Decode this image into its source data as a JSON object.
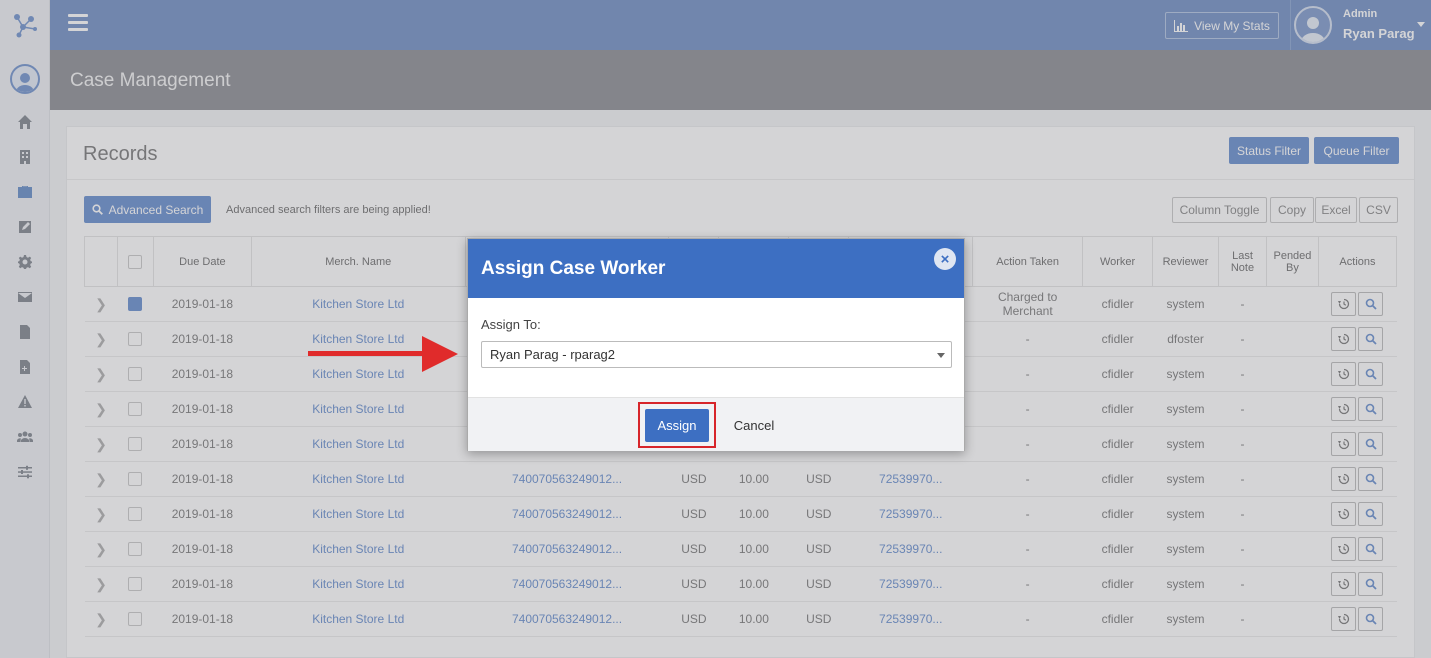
{
  "topbar": {
    "stats_label": "View My Stats",
    "user_role": "Admin",
    "user_name": "Ryan Parag"
  },
  "page": {
    "title": "Case Management"
  },
  "records": {
    "title": "Records",
    "status_filter": "Status Filter",
    "queue_filter": "Queue Filter",
    "advanced_search": "Advanced Search",
    "advanced_note": "Advanced search filters are being applied!",
    "column_toggle": "Column Toggle",
    "copy": "Copy",
    "excel": "Excel",
    "csv": "CSV"
  },
  "table": {
    "headers": {
      "due_date": "Due Date",
      "merch_name": "Merch. Name",
      "action_taken": "Action Taken",
      "worker": "Worker",
      "reviewer": "Reviewer",
      "last_note": "Last Note",
      "pended_by": "Pended By",
      "actions": "Actions"
    },
    "rows": [
      {
        "date": "2019-01-18",
        "merchant": "Kitchen Store Ltd",
        "card": "",
        "cur1": "",
        "amount": "",
        "cur2": "",
        "ref": "",
        "action": "Charged to Merchant",
        "worker": "cfidler",
        "reviewer": "system",
        "note": "-",
        "checked": true
      },
      {
        "date": "2019-01-18",
        "merchant": "Kitchen Store Ltd",
        "card": "",
        "cur1": "",
        "amount": "",
        "cur2": "",
        "ref": "",
        "action": "-",
        "worker": "cfidler",
        "reviewer": "dfoster",
        "note": "-",
        "checked": false
      },
      {
        "date": "2019-01-18",
        "merchant": "Kitchen Store Ltd",
        "card": "",
        "cur1": "",
        "amount": "",
        "cur2": "",
        "ref": "",
        "action": "-",
        "worker": "cfidler",
        "reviewer": "system",
        "note": "-",
        "checked": false
      },
      {
        "date": "2019-01-18",
        "merchant": "Kitchen Store Ltd",
        "card": "",
        "cur1": "",
        "amount": "",
        "cur2": "",
        "ref": "",
        "action": "-",
        "worker": "cfidler",
        "reviewer": "system",
        "note": "-",
        "checked": false
      },
      {
        "date": "2019-01-18",
        "merchant": "Kitchen Store Ltd",
        "card": "",
        "cur1": "",
        "amount": "",
        "cur2": "",
        "ref": "",
        "action": "-",
        "worker": "cfidler",
        "reviewer": "system",
        "note": "-",
        "checked": false
      },
      {
        "date": "2019-01-18",
        "merchant": "Kitchen Store Ltd",
        "card": "740070563249012...",
        "cur1": "USD",
        "amount": "10.00",
        "cur2": "USD",
        "ref": "72539970...",
        "action": "-",
        "worker": "cfidler",
        "reviewer": "system",
        "note": "-",
        "checked": false
      },
      {
        "date": "2019-01-18",
        "merchant": "Kitchen Store Ltd",
        "card": "740070563249012...",
        "cur1": "USD",
        "amount": "10.00",
        "cur2": "USD",
        "ref": "72539970...",
        "action": "-",
        "worker": "cfidler",
        "reviewer": "system",
        "note": "-",
        "checked": false
      },
      {
        "date": "2019-01-18",
        "merchant": "Kitchen Store Ltd",
        "card": "740070563249012...",
        "cur1": "USD",
        "amount": "10.00",
        "cur2": "USD",
        "ref": "72539970...",
        "action": "-",
        "worker": "cfidler",
        "reviewer": "system",
        "note": "-",
        "checked": false
      },
      {
        "date": "2019-01-18",
        "merchant": "Kitchen Store Ltd",
        "card": "740070563249012...",
        "cur1": "USD",
        "amount": "10.00",
        "cur2": "USD",
        "ref": "72539970...",
        "action": "-",
        "worker": "cfidler",
        "reviewer": "system",
        "note": "-",
        "checked": false
      },
      {
        "date": "2019-01-18",
        "merchant": "Kitchen Store Ltd",
        "card": "740070563249012...",
        "cur1": "USD",
        "amount": "10.00",
        "cur2": "USD",
        "ref": "72539970...",
        "action": "-",
        "worker": "cfidler",
        "reviewer": "system",
        "note": "-",
        "checked": false
      }
    ]
  },
  "modal": {
    "title": "Assign Case Worker",
    "label": "Assign To:",
    "selected": "Ryan Parag - rparag2",
    "assign": "Assign",
    "cancel": "Cancel"
  },
  "colors": {
    "topbar": "#4c72b5",
    "primary": "#3d6fc2",
    "header_bar": "#6d7077",
    "highlight": "#d7252a"
  }
}
